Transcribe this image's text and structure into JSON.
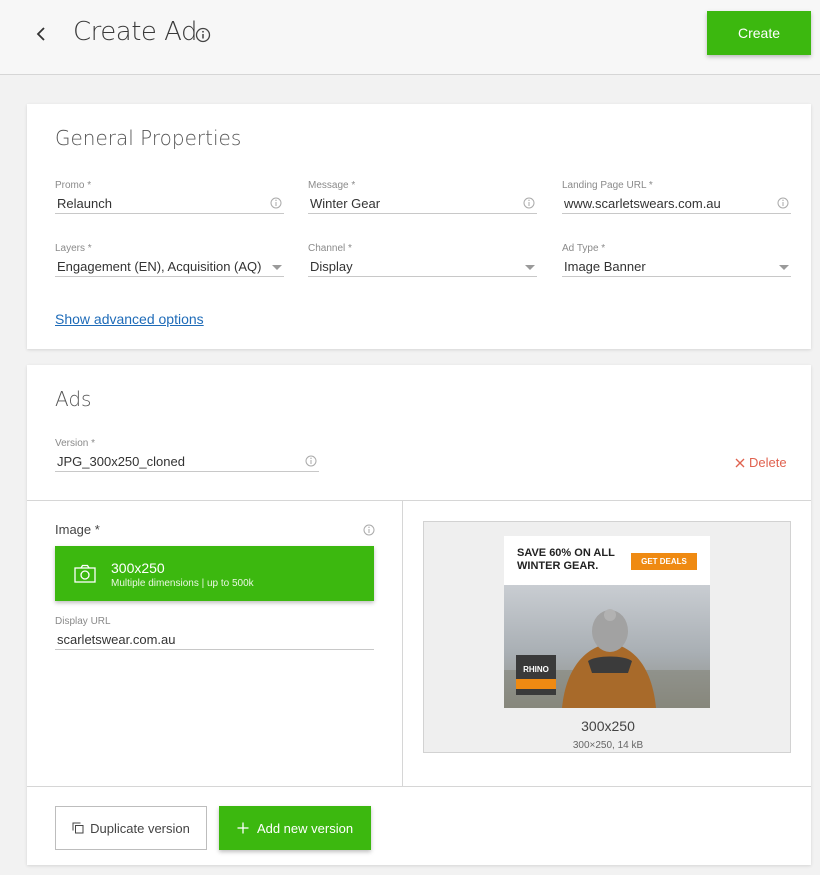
{
  "header": {
    "title": "Create Ad",
    "create_label": "Create"
  },
  "general": {
    "title": "General Properties",
    "fields": [
      {
        "label": "Promo *",
        "value": "Relaunch"
      },
      {
        "label": "Message *",
        "value": "Winter Gear"
      },
      {
        "label": "Landing Page URL *",
        "value": "www.scarletswears.com.au"
      },
      {
        "label": "Layers *",
        "value": "Engagement (EN), Acquisition (AQ)"
      },
      {
        "label": "Channel *",
        "value": "Display"
      },
      {
        "label": "Ad Type *",
        "value": "Image Banner"
      }
    ],
    "advanced_link": "Show advanced options"
  },
  "ads": {
    "title": "Ads",
    "version_label": "Version *",
    "version_value": "JPG_300x250_cloned",
    "delete_label": "Delete",
    "image_label": "Image *",
    "upload_dimensions": "300x250",
    "upload_hint": "Multiple dimensions | up to 500k",
    "display_url_label": "Display URL",
    "display_url_value": "scarletswear.com.au",
    "preview": {
      "headline": "SAVE 60% ON ALL WINTER GEAR.",
      "cta": "GET DEALS",
      "brand": "RHINO",
      "name": "300x250",
      "meta": "300×250, 14 kB"
    },
    "duplicate_label": "Duplicate version",
    "add_label": "Add new version"
  },
  "colors": {
    "accent": "#3cb80f",
    "link": "#1e6bb8",
    "danger": "#e0624f",
    "ad_orange": "#ef8a12"
  }
}
